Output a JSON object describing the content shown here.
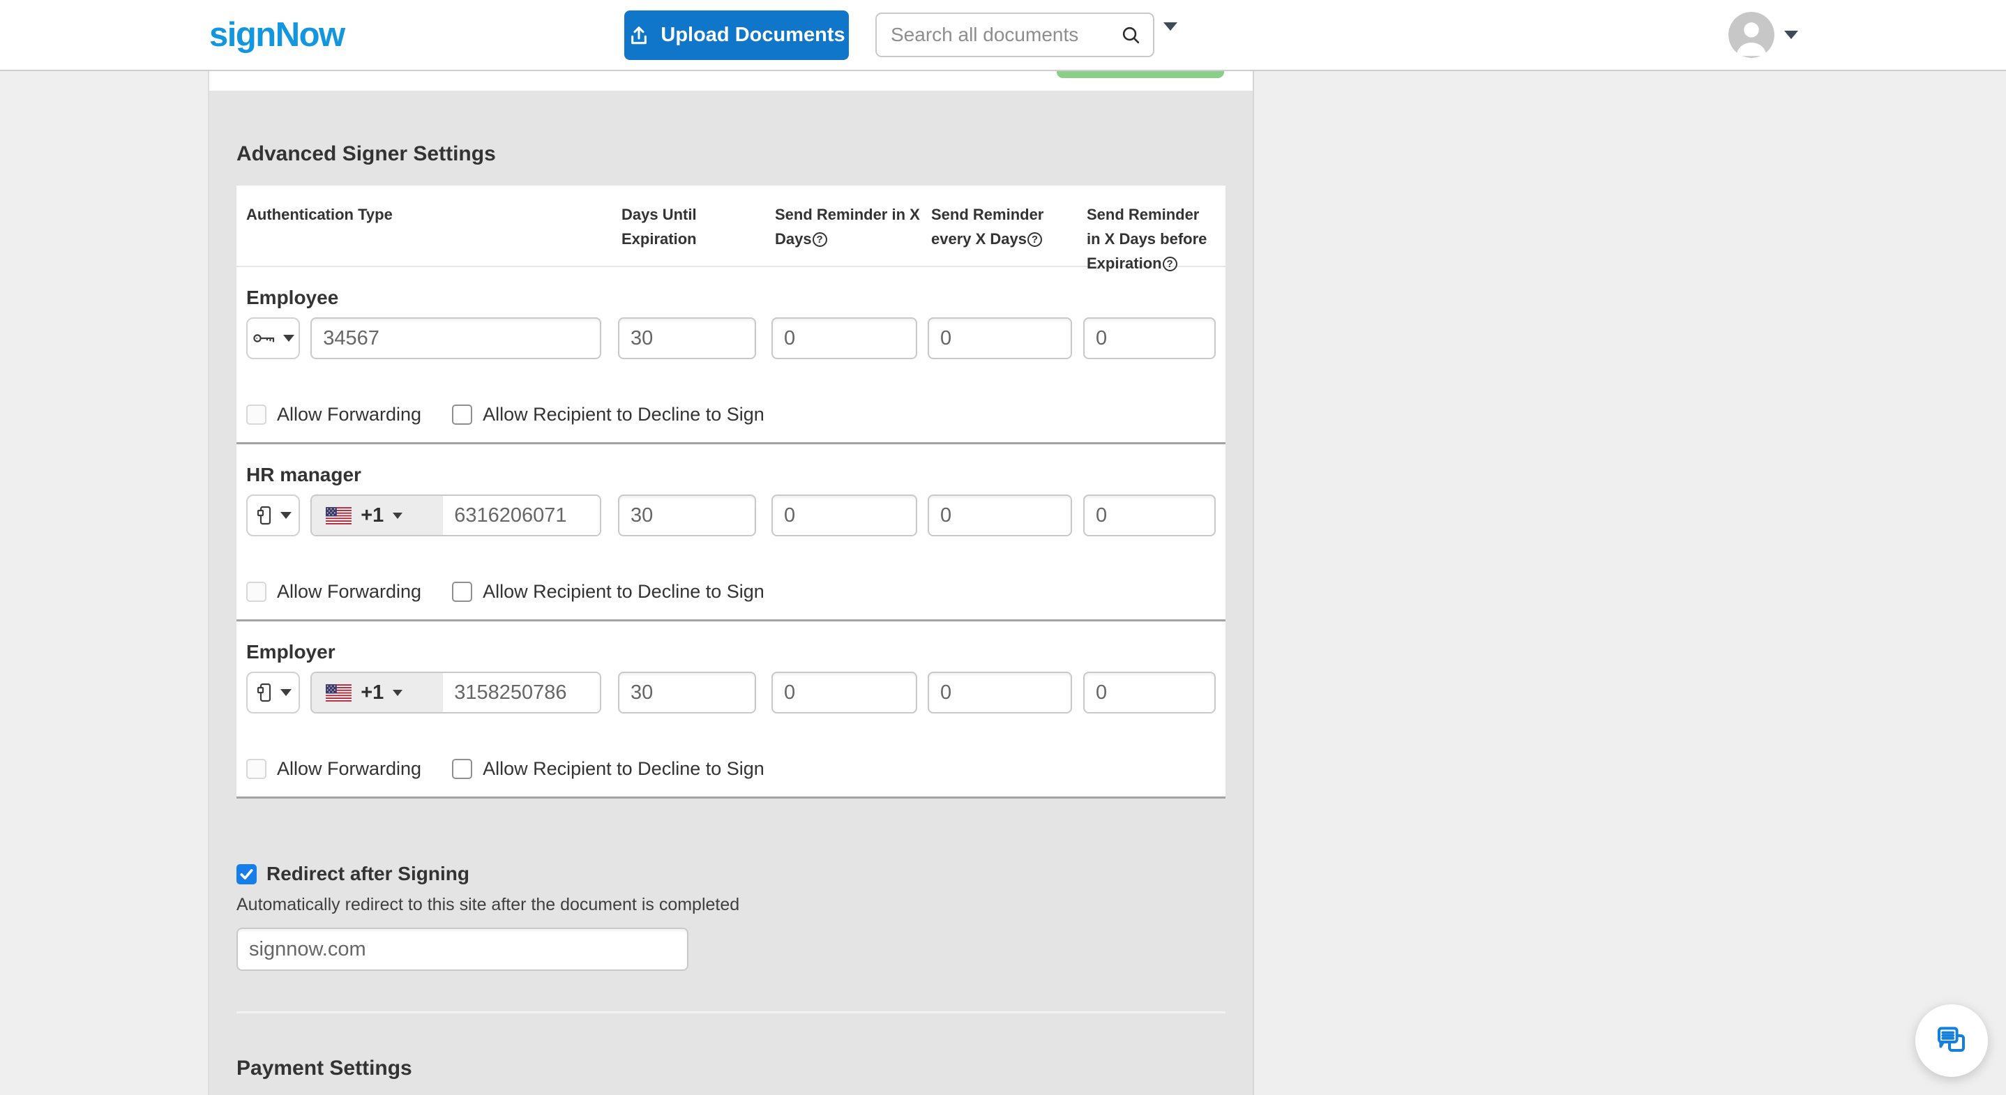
{
  "header": {
    "logo_text": "signNow",
    "upload_button_label": "Upload Documents",
    "search_placeholder": "Search all documents"
  },
  "advanced_signer_settings": {
    "title": "Advanced Signer Settings",
    "columns": [
      "Authentication Type",
      "Days Until Expiration",
      "Send Reminder in X Days",
      "Send Reminder every X Days",
      "Send Reminder in X Days before Expiration"
    ],
    "checkbox_labels": {
      "allow_forwarding": "Allow Forwarding",
      "allow_decline": "Allow Recipient to Decline to Sign"
    },
    "rows": [
      {
        "name": "Employee",
        "auth_type": "password",
        "auth_icon": "key-icon",
        "value": "34567",
        "days_until_expiration": "30",
        "send_reminder_in_x_days": "0",
        "send_reminder_every_x_days": "0",
        "send_reminder_before_expiration": "0",
        "allow_forwarding": false,
        "allow_decline": false
      },
      {
        "name": "HR manager",
        "auth_type": "phone",
        "auth_icon": "mobile-phone-icon",
        "flag": "us-flag-icon",
        "dial_code": "+1",
        "value": "6316206071",
        "days_until_expiration": "30",
        "send_reminder_in_x_days": "0",
        "send_reminder_every_x_days": "0",
        "send_reminder_before_expiration": "0",
        "allow_forwarding": false,
        "allow_decline": false
      },
      {
        "name": "Employer",
        "auth_type": "phone",
        "auth_icon": "mobile-phone-icon",
        "flag": "us-flag-icon",
        "dial_code": "+1",
        "value": "3158250786",
        "days_until_expiration": "30",
        "send_reminder_in_x_days": "0",
        "send_reminder_every_x_days": "0",
        "send_reminder_before_expiration": "0",
        "allow_forwarding": false,
        "allow_decline": false
      }
    ]
  },
  "redirect_after_signing": {
    "label": "Redirect after Signing",
    "checked": true,
    "helper_text": "Automatically redirect to this site after the document is completed",
    "url_value": "signnow.com"
  },
  "payment_settings": {
    "title": "Payment Settings"
  },
  "icons": {
    "help_glyph": "?"
  },
  "colors": {
    "brand_blue": "#1296e0",
    "primary_button_blue": "#0f76c9",
    "checkbox_checked_blue": "#157ee8",
    "partial_button_green": "#8bcd8a",
    "panel_gray": "#e4e4e4",
    "page_gray": "#efefef"
  }
}
